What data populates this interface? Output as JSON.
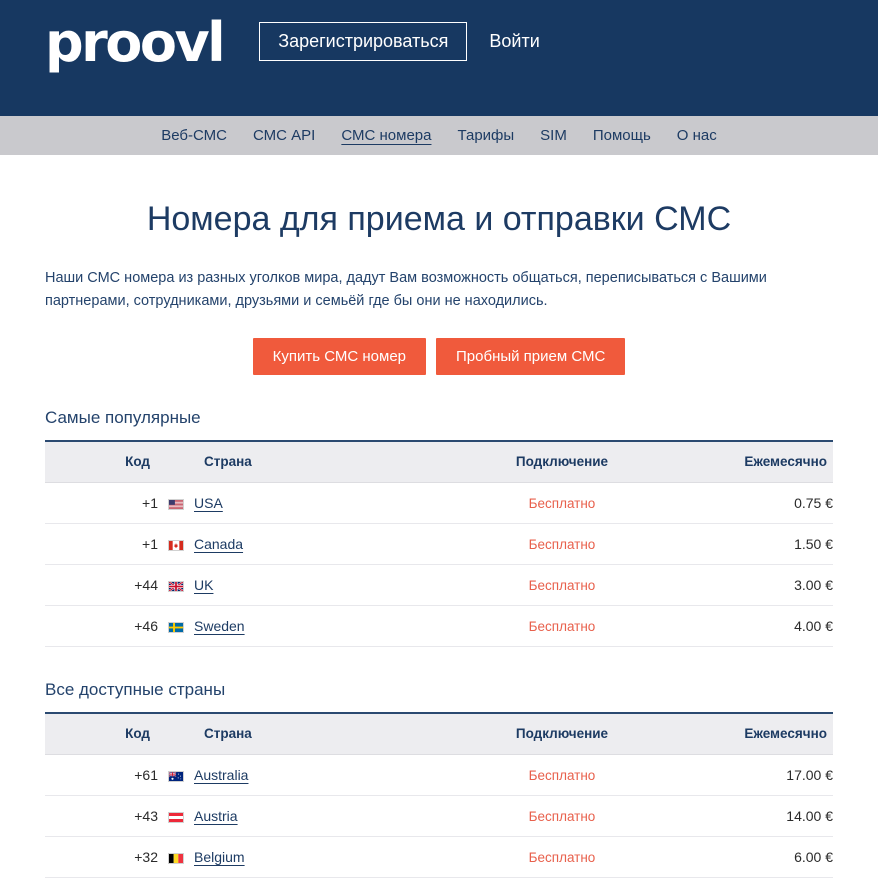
{
  "header": {
    "logo_text": "proovl",
    "register_label": "Зарегистрироваться",
    "login_label": "Войти",
    "bg_color": "#173861"
  },
  "nav": {
    "bg_color": "#c9c9cd",
    "items": [
      {
        "label": "Веб-СМС",
        "active": false
      },
      {
        "label": "СМС API",
        "active": false
      },
      {
        "label": "СМС номера",
        "active": true
      },
      {
        "label": "Тарифы",
        "active": false
      },
      {
        "label": "SIM",
        "active": false
      },
      {
        "label": "Помощь",
        "active": false
      },
      {
        "label": "О нас",
        "active": false
      }
    ]
  },
  "main": {
    "title": "Номера для приема и отправки СМС",
    "description": "Наши СМС номера из разных уголков мира, дадут Вам возможность общаться, переписываться с Вашими партнерами, сотрудниками, друзьями и семьёй где бы они не находились.",
    "cta_buy": "Купить СМС номер",
    "cta_trial": "Пробный прием СМС",
    "cta_color": "#f05a3c"
  },
  "table_headers": {
    "code": "Код",
    "country": "Страна",
    "connection": "Подключение",
    "monthly": "Ежемесячно"
  },
  "free_label": "Бесплатно",
  "free_color": "#e8604c",
  "sections": [
    {
      "title": "Самые популярные",
      "rows": [
        {
          "code": "+1",
          "flag": "flag-usa",
          "country": "USA",
          "connection": "Бесплатно",
          "monthly": "0.75 €"
        },
        {
          "code": "+1",
          "flag": "flag-canada",
          "country": "Canada",
          "connection": "Бесплатно",
          "monthly": "1.50 €"
        },
        {
          "code": "+44",
          "flag": "flag-uk",
          "country": "UK",
          "connection": "Бесплатно",
          "monthly": "3.00 €"
        },
        {
          "code": "+46",
          "flag": "flag-sweden",
          "country": "Sweden",
          "connection": "Бесплатно",
          "monthly": "4.00 €"
        }
      ]
    },
    {
      "title": "Все доступные страны",
      "rows": [
        {
          "code": "+61",
          "flag": "flag-australia",
          "country": "Australia",
          "connection": "Бесплатно",
          "monthly": "17.00 €"
        },
        {
          "code": "+43",
          "flag": "flag-austria",
          "country": "Austria",
          "connection": "Бесплатно",
          "monthly": "14.00 €"
        },
        {
          "code": "+32",
          "flag": "flag-belgium",
          "country": "Belgium",
          "connection": "Бесплатно",
          "monthly": "6.00 €"
        }
      ]
    }
  ]
}
